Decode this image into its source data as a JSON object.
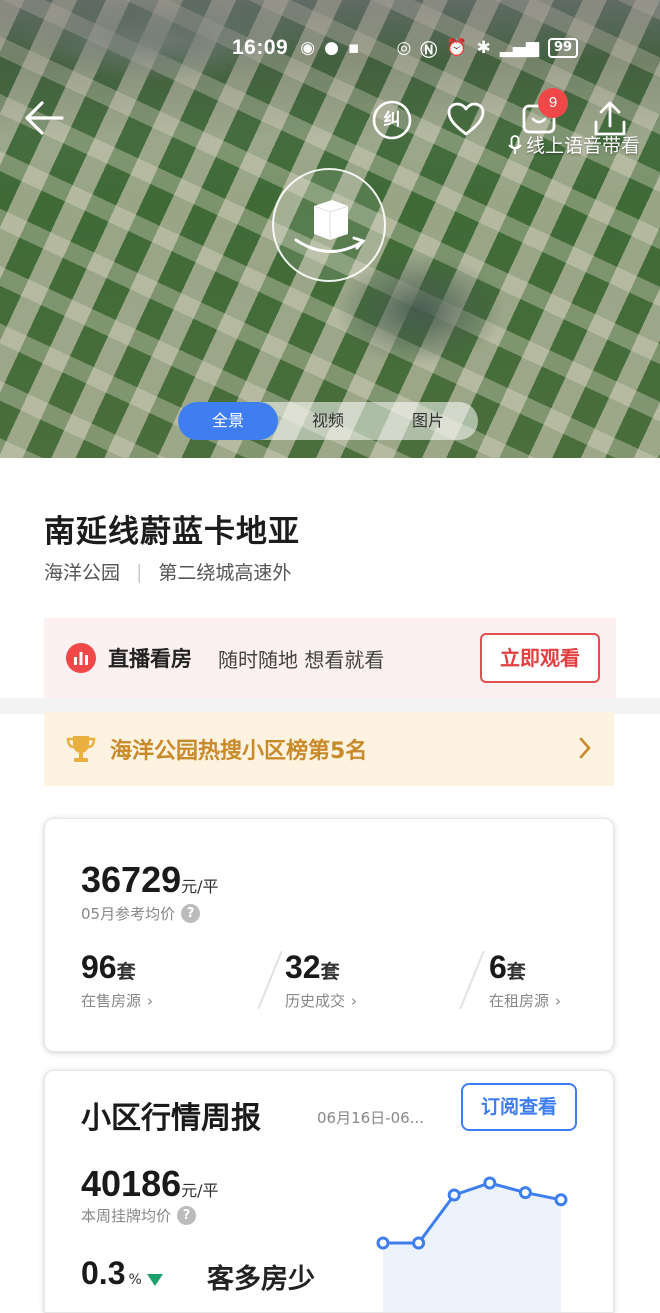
{
  "status_bar": {
    "time": "16:09",
    "battery": "99"
  },
  "header": {
    "cart_badge": "9",
    "voice_label": "线上语音带看",
    "subway_icon_text": "纠"
  },
  "media_tabs": [
    {
      "label": "全景"
    },
    {
      "label": "视频"
    },
    {
      "label": "图片"
    }
  ],
  "community": {
    "name": "南延线蔚蓝卡地亚",
    "district": "海洋公园",
    "location": "第二绕城高速外"
  },
  "live": {
    "label": "直播看房",
    "desc": "随时随地 想看就看",
    "button": "立即观看"
  },
  "rank": {
    "text": "海洋公园热搜小区榜第5名"
  },
  "price_card": {
    "avg_price": "36729",
    "price_unit": "元/平",
    "price_note": "05月参考均价",
    "stats": [
      {
        "value": "96",
        "unit": "套",
        "label": "在售房源"
      },
      {
        "value": "32",
        "unit": "套",
        "label": "历史成交"
      },
      {
        "value": "6",
        "unit": "套",
        "label": "在租房源"
      }
    ]
  },
  "weekly": {
    "title": "小区行情周报",
    "date_range": "06月16日-06...",
    "subscribe": "订阅查看",
    "listing_price": "40186",
    "listing_unit": "元/平",
    "listing_note": "本周挂牌均价",
    "change": "0.3",
    "change_unit": "%",
    "trend_text": "客多房少"
  },
  "chart_data": {
    "type": "line",
    "values": [
      1,
      1,
      3,
      3.5,
      3.1,
      2.8
    ]
  }
}
